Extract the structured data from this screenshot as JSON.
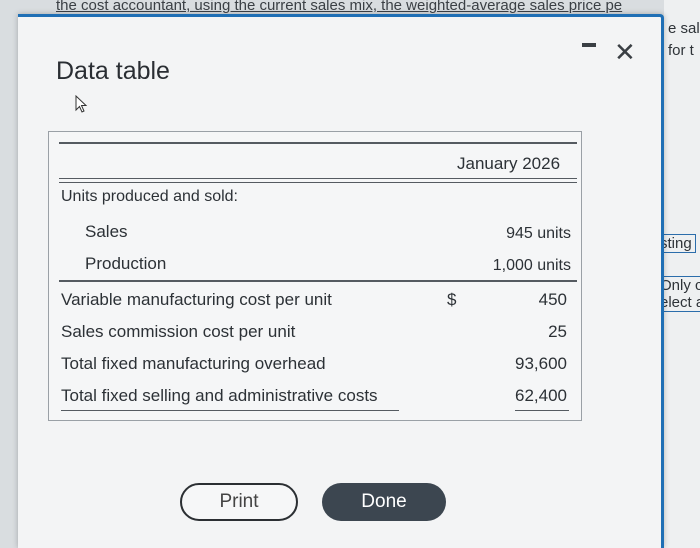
{
  "background": {
    "top_text": "the cost accountant, using the current sales mix, the weighted-average sales price pe",
    "right_fragments": [
      "e sal",
      "for t",
      "sting",
      "Only c",
      "elect a"
    ]
  },
  "dialog": {
    "title": "Data table",
    "close_glyph": "✕"
  },
  "table": {
    "column_header": "January 2026",
    "section_label": "Units produced and sold:",
    "rows": [
      {
        "label": "Sales",
        "currency": "",
        "value": "945 units"
      },
      {
        "label": "Production",
        "currency": "",
        "value": "1,000 units"
      },
      {
        "label": "Variable manufacturing cost per unit",
        "currency": "$",
        "value": "450"
      },
      {
        "label": "Sales commission cost per unit",
        "currency": "",
        "value": "25"
      },
      {
        "label": "Total fixed manufacturing overhead",
        "currency": "",
        "value": "93,600"
      },
      {
        "label": "Total fixed selling and administrative costs",
        "currency": "",
        "value": "62,400"
      }
    ]
  },
  "buttons": {
    "print": "Print",
    "done": "Done"
  },
  "colors": {
    "accent_border": "#1f6fb5",
    "done_bg": "#3c4650"
  }
}
